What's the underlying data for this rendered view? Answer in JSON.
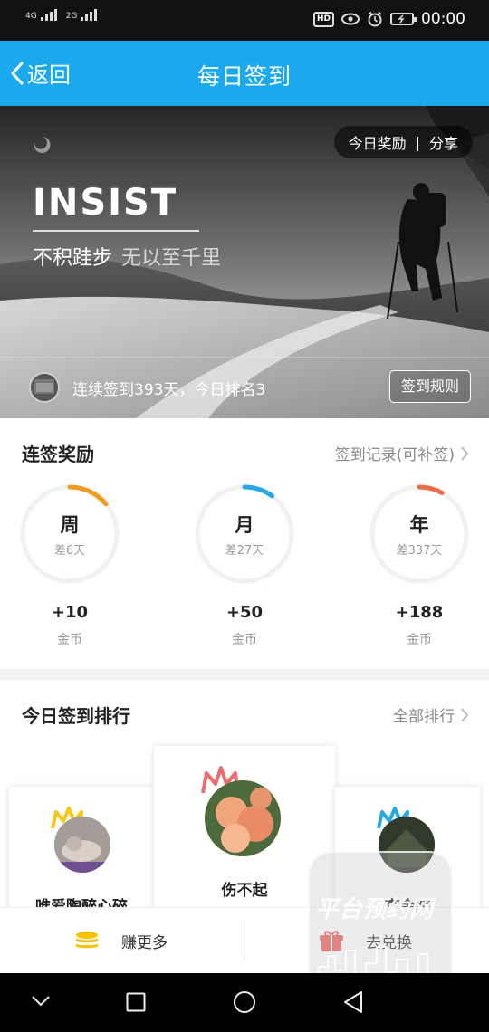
{
  "status_bar": {
    "signal1_label": "4G",
    "signal2_label": "2G",
    "hd_badge": "HD",
    "time": "00:00"
  },
  "header": {
    "back_label": "返回",
    "title": "每日签到"
  },
  "banner": {
    "today_reward_label": "今日奖励",
    "separator": "|",
    "share_label": "分享",
    "headline": "INSIST",
    "motto_bold": "不积跬步",
    "motto_light": "无以至千里",
    "streak_text": "连续签到393天，今日排名3",
    "rules_button": "签到规则"
  },
  "reward": {
    "title": "连签奖励",
    "records_link": "签到记录(可补签)",
    "rings": [
      {
        "label": "周",
        "sub": "差6天",
        "amount": "+10",
        "unit": "金币",
        "color": "#f29a1f",
        "progress": 0.14
      },
      {
        "label": "月",
        "sub": "差27天",
        "amount": "+50",
        "unit": "金币",
        "color": "#27a8e6",
        "progress": 0.1
      },
      {
        "label": "年",
        "sub": "差337天",
        "amount": "+188",
        "unit": "金币",
        "color": "#ef6b47",
        "progress": 0.08
      }
    ]
  },
  "ranking": {
    "title": "今日签到排行",
    "all_link": "全部排行",
    "entries": [
      {
        "name": "唯爱陶醉心碎",
        "crown_color": "#f5c518"
      },
      {
        "name": "伤不起",
        "crown_color": "#ef6b6b"
      },
      {
        "name": "李金明",
        "crown_color": "#27a8e6"
      }
    ]
  },
  "actions": {
    "earn_more": "赚更多",
    "exchange": "去兑换"
  },
  "watermark": {
    "text": "平台预约网"
  }
}
